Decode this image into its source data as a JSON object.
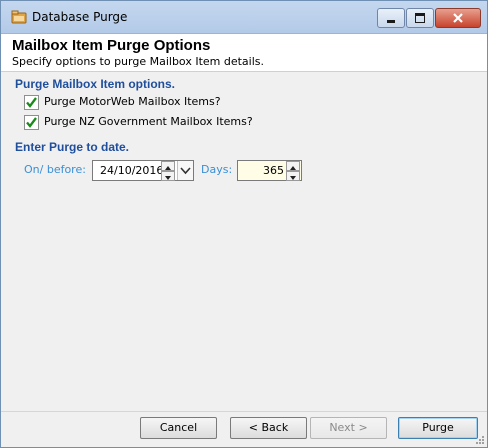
{
  "window": {
    "title": "Database Purge"
  },
  "header": {
    "title": "Mailbox Item Purge Options",
    "subtitle": "Specify options to purge Mailbox Item details."
  },
  "purge_options": {
    "section_title": "Purge Mailbox Item options.",
    "items": [
      {
        "label": "Purge MotorWeb Mailbox Items?",
        "checked": true
      },
      {
        "label": "Purge NZ Government Mailbox Items?",
        "checked": true
      }
    ]
  },
  "purge_date": {
    "section_title": "Enter Purge to date.",
    "on_before_label": "On/ before:",
    "date_value": "24/10/2016",
    "days_label": "Days:",
    "days_value": "365"
  },
  "buttons": {
    "cancel": "Cancel",
    "back": "< Back",
    "next": "Next >",
    "purge": "Purge"
  },
  "colors": {
    "section_title": "#1f4e9c",
    "field_label": "#3a8fd6",
    "check_mark": "#1a8a1a",
    "days_field_bg": "#fffde6"
  }
}
